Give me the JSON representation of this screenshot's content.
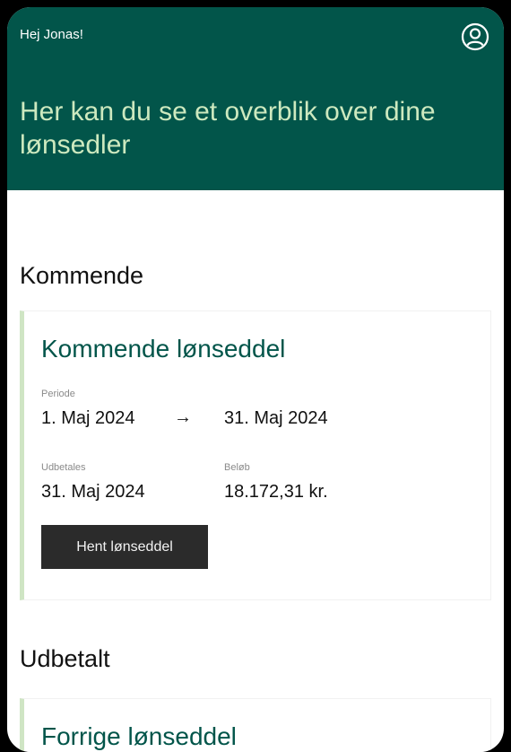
{
  "header": {
    "greeting": "Hej Jonas!",
    "title": "Her kan du se et overblik over dine lønsedler",
    "profile_icon": "user-circle-icon"
  },
  "upcoming": {
    "section_title": "Kommende",
    "card": {
      "title": "Kommende lønseddel",
      "period_label": "Periode",
      "period_start": "1. Maj 2024",
      "period_end": "31. Maj 2024",
      "arrow": "→",
      "payout_label": "Udbetales",
      "payout_value": "31. Maj 2024",
      "amount_label": "Beløb",
      "amount_value": "18.172,31 kr.",
      "button_label": "Hent lønseddel"
    }
  },
  "paid": {
    "section_title": "Udbetalt",
    "card": {
      "title": "Forrige lønseddel"
    }
  },
  "colors": {
    "header_bg": "#02554a",
    "hero_text": "#cde9bf",
    "card_accent": "#cfe5c4",
    "button_bg": "#2b2b2b"
  }
}
